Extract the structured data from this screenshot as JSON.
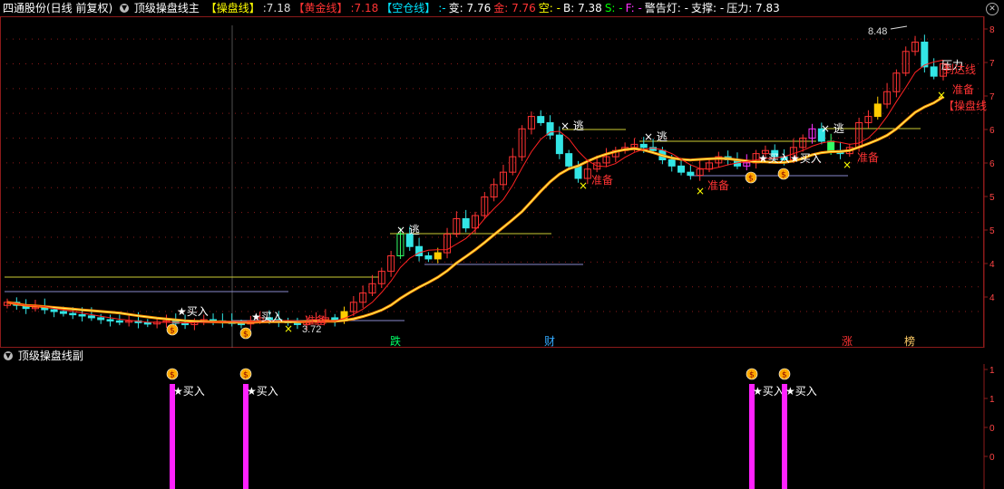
{
  "header": {
    "stock": "四通股份(日线 前复权)",
    "indicator": "顶级操盘线主",
    "items": [
      {
        "label": "【操盘线】",
        "color": "#ffff00"
      },
      {
        "label": ":7.18",
        "color": "#dddddd"
      },
      {
        "label": "【黄金线】",
        "color": "#ff3333"
      },
      {
        "label": ":7.18",
        "color": "#ff3333"
      },
      {
        "label": "【空仓线】",
        "color": "#00e5ff"
      },
      {
        "label": ":-",
        "color": "#00e5ff"
      },
      {
        "label": "变: 7.76",
        "color": "#ffffff"
      },
      {
        "label": "金: 7.76",
        "color": "#ff3333"
      },
      {
        "label": "空: -",
        "color": "#ffff00"
      },
      {
        "label": "B: 7.38",
        "color": "#ffffff"
      },
      {
        "label": "S: -",
        "color": "#00ff00"
      },
      {
        "label": "F: -",
        "color": "#ff33ff"
      },
      {
        "label": "警告灯: -",
        "color": "#ffffff"
      },
      {
        "label": "支撑: -",
        "color": "#ffffff"
      },
      {
        "label": "压力: 7.83",
        "color": "#ffffff"
      }
    ]
  },
  "sub_panel": {
    "title": "顶级操盘线副"
  },
  "axis": {
    "main_ticks": [
      "8",
      "7",
      "7",
      "6",
      "6",
      "5",
      "5",
      "4",
      "4"
    ],
    "sub_ticks": [
      "1",
      "1",
      "0",
      "0"
    ]
  },
  "chart_data": {
    "type": "candlestick",
    "high_label": "8.48",
    "low_label": "3.72",
    "closes": [
      4.1,
      4.05,
      4.0,
      4.02,
      3.98,
      3.95,
      3.92,
      3.9,
      3.88,
      3.85,
      3.82,
      3.8,
      3.78,
      3.8,
      3.77,
      3.75,
      3.78,
      3.8,
      3.76,
      3.74,
      3.78,
      3.82,
      3.8,
      3.78,
      3.76,
      3.75,
      3.8,
      3.85,
      3.82,
      3.79,
      3.77,
      3.74,
      3.78,
      3.82,
      3.85,
      3.8,
      3.95,
      4.1,
      4.25,
      4.4,
      4.6,
      4.85,
      5.2,
      5.0,
      4.85,
      4.8,
      4.9,
      5.2,
      5.45,
      5.3,
      5.5,
      5.8,
      6.0,
      6.2,
      6.45,
      6.9,
      7.1,
      7.0,
      6.8,
      6.5,
      6.3,
      6.1,
      6.25,
      6.35,
      6.45,
      6.55,
      6.6,
      6.65,
      6.6,
      6.55,
      6.4,
      6.3,
      6.2,
      6.15,
      6.25,
      6.35,
      6.45,
      6.4,
      6.3,
      6.35,
      6.5,
      6.55,
      6.45,
      6.4,
      6.6,
      6.75,
      6.9,
      6.7,
      6.55,
      6.5,
      6.6,
      7.0,
      7.1,
      7.3,
      7.5,
      7.8,
      8.15,
      8.3,
      7.9,
      7.75,
      7.95
    ],
    "ma_end": 7.18,
    "annotations": [
      {
        "label": "买入"
      },
      {
        "label": "买入"
      },
      {
        "label": "买入"
      },
      {
        "label": "买入"
      },
      {
        "label": "买入"
      },
      {
        "label": "买入"
      },
      {
        "label": "准备"
      },
      {
        "label": "准备"
      },
      {
        "label": "准备"
      },
      {
        "label": "准备"
      },
      {
        "label": "准备"
      },
      {
        "label": "逃"
      },
      {
        "label": "逃"
      },
      {
        "label": "逃"
      },
      {
        "label": "逃"
      },
      {
        "label": "压力"
      },
      {
        "label": "到达线"
      },
      {
        "label": "【操盘线"
      }
    ],
    "bottom_markers": [
      {
        "label": "跌",
        "color": "#00ff66"
      },
      {
        "label": "财",
        "color": "#33aaff"
      },
      {
        "label": "涨",
        "color": "#ff3333"
      },
      {
        "label": "榜",
        "color": "#ffcc66"
      }
    ],
    "sub_signals": [
      {
        "label": "买入"
      },
      {
        "label": "买入"
      },
      {
        "label": "买入"
      },
      {
        "label": "买入"
      }
    ]
  }
}
